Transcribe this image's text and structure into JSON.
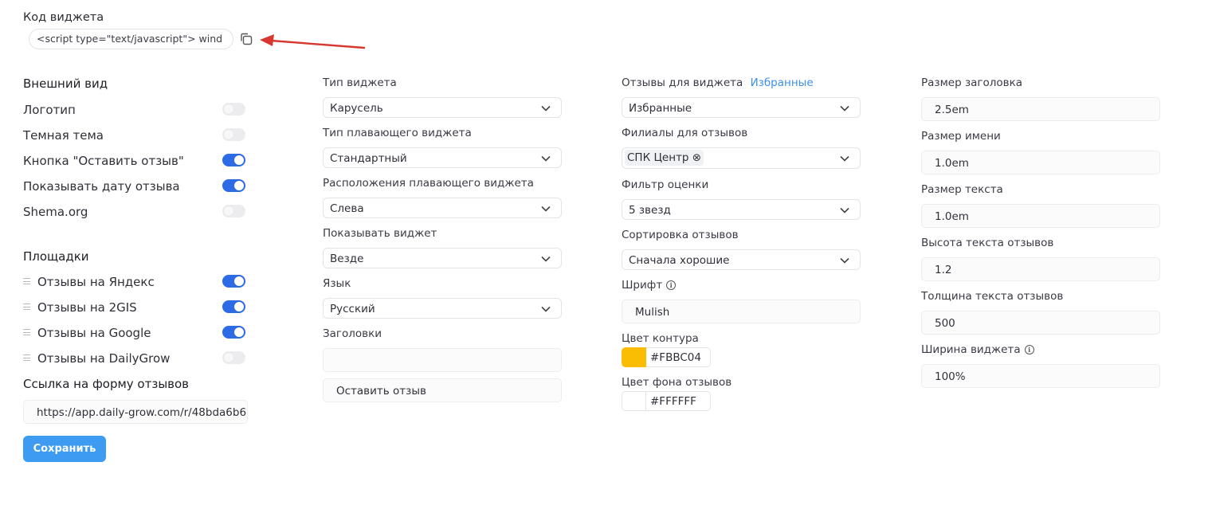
{
  "widget_code": {
    "label": "Код виджета",
    "value": "<script type=\"text/javascript\">   wind"
  },
  "appearance": {
    "heading": "Внешний вид",
    "toggles": [
      {
        "label": "Логотип",
        "on": false
      },
      {
        "label": "Темная тема",
        "on": false
      },
      {
        "label": "Кнопка \"Оставить отзыв\"",
        "on": true
      },
      {
        "label": "Показывать дату отзыва",
        "on": true
      },
      {
        "label": "Shema.org",
        "on": false
      }
    ]
  },
  "platforms": {
    "heading": "Площадки",
    "items": [
      {
        "label": "Отзывы на Яндекс",
        "on": true
      },
      {
        "label": "Отзывы на 2GIS",
        "on": true
      },
      {
        "label": "Отзывы на Google",
        "on": true
      },
      {
        "label": "Отзывы на DailyGrow",
        "on": false
      }
    ]
  },
  "review_form": {
    "label": "Ссылка на форму отзывов",
    "url": "https://app.daily-grow.com/r/48bda6b6"
  },
  "save_label": "Сохранить",
  "widget_settings": {
    "widget_type": {
      "label": "Тип виджета",
      "value": "Карусель"
    },
    "floating_type": {
      "label": "Тип плавающего виджета",
      "value": "Стандартный"
    },
    "floating_position": {
      "label": "Расположения плавающего виджета",
      "value": "Слева"
    },
    "show_widget": {
      "label": "Показывать виджет",
      "value": "Везде"
    },
    "language": {
      "label": "Язык",
      "value": "Русский"
    },
    "headings": {
      "label": "Заголовки",
      "value": "",
      "button_value": "Оставить отзыв"
    }
  },
  "reviews_settings": {
    "reviews_for_widget": {
      "label": "Отзывы для виджета",
      "link": "Избранные",
      "value": "Избранные"
    },
    "branches": {
      "label": "Филиалы для отзывов",
      "tag": "СПК Центр ⊗"
    },
    "rating_filter": {
      "label": "Фильтр оценки",
      "value": "5 звезд"
    },
    "sorting": {
      "label": "Сортировка отзывов",
      "value": "Сначала хорошие"
    },
    "font": {
      "label": "Шрифт",
      "value": "Mulish"
    },
    "outline_color": {
      "label": "Цвет контура",
      "value": "#FBBC04"
    },
    "bg_color": {
      "label": "Цвет фона отзывов",
      "value": "#FFFFFF"
    }
  },
  "size_settings": {
    "heading_size": {
      "label": "Размер заголовка",
      "value": "2.5em"
    },
    "name_size": {
      "label": "Размер имени",
      "value": "1.0em"
    },
    "text_size": {
      "label": "Размер текста",
      "value": "1.0em"
    },
    "line_height": {
      "label": "Высота текста отзывов",
      "value": "1.2"
    },
    "font_weight": {
      "label": "Толщина текста отзывов",
      "value": "500"
    },
    "widget_width": {
      "label": "Ширина виджета",
      "value": "100%"
    }
  },
  "colors": {
    "toggle_on": "#2c6ae6",
    "toggle_off": "#ececef",
    "save_button": "#3d9bf2",
    "outline_swatch": "#FBBC04",
    "bg_swatch": "#FFFFFF",
    "arrow": "#d8372f"
  }
}
